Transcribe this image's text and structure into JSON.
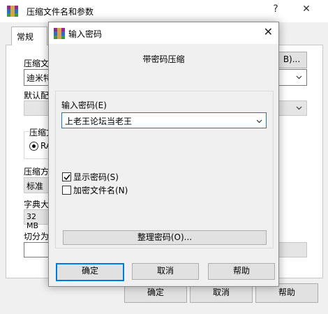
{
  "back_window": {
    "title": "压缩文件名和参数",
    "help_glyph": "?",
    "close_glyph": "✕",
    "tab_general": "常规",
    "label_archive": "压缩文",
    "archive_value": "迪米特",
    "browse_label": "B)...",
    "label_default": "默认配",
    "label_format": "压缩文",
    "format_option": "RA",
    "label_method": "压缩方",
    "method_value": "标准",
    "label_dict": "字典大",
    "dict_value": "32 MB",
    "label_split": "切分为",
    "ok": "确定",
    "cancel": "取消",
    "help": "帮助"
  },
  "dialog": {
    "title": "输入密码",
    "close_glyph": "✕",
    "subtitle": "带密码压缩",
    "password_label": "输入密码(E)",
    "password_value": "上老王论坛当老王",
    "show_password_label": "显示密码(S)",
    "show_password_checked": true,
    "encrypt_names_label": "加密文件名(N)",
    "encrypt_names_checked": false,
    "manage_label": "整理密码(O)...",
    "ok": "确定",
    "cancel": "取消",
    "help": "帮助"
  }
}
